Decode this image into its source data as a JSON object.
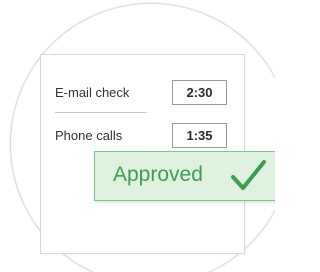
{
  "rows": [
    {
      "label": "E-mail check",
      "time": "2:30"
    },
    {
      "label": "Phone calls",
      "time": "1:35"
    }
  ],
  "status": {
    "label": "Approved",
    "icon": "checkmark-icon",
    "text_color": "#3e9e4f",
    "bg_color": "#dff2e0",
    "border_color": "#82c78a"
  }
}
